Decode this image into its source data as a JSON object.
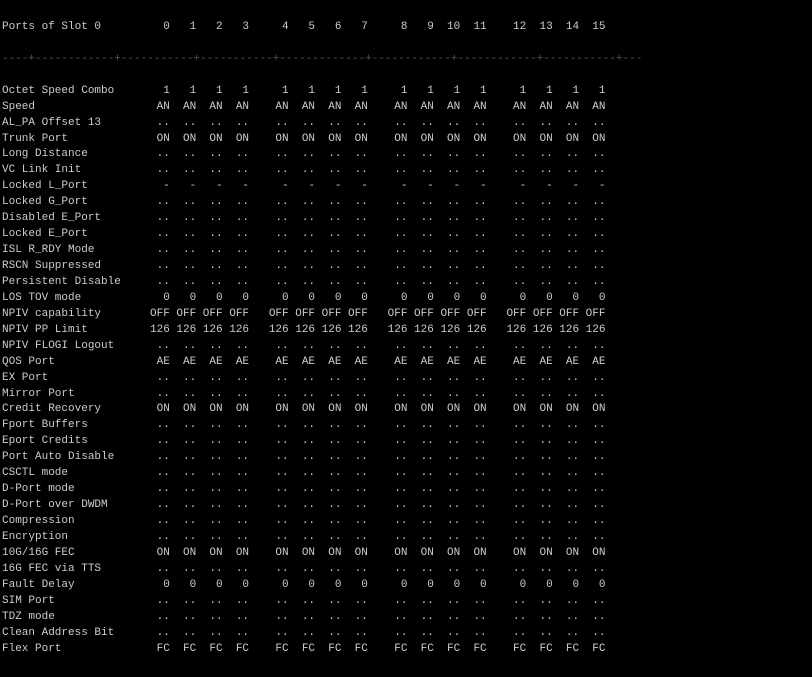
{
  "title": "Ports of Slot 0",
  "header": {
    "label": "Ports of Slot 0",
    "cols": "  0   1   2   3     4   5   6   7     8   9  10  11    12  13  14  15"
  },
  "separator": "----+---------+---------+---------+----------+---------+---------+-----------+---",
  "rows": [
    {
      "label": "Octet Speed Combo",
      "values": "  1   1   1   1     1   1   1   1     1   1   1   1     1   1   1   1"
    },
    {
      "label": "Speed",
      "values": " AN  AN  AN  AN    AN  AN  AN  AN    AN  AN  AN  AN    AN  AN  AN  AN"
    },
    {
      "label": "AL_PA Offset 13",
      "values": " ..  ..  ..  ..    ..  ..  ..  ..    ..  ..  ..  ..    ..  ..  ..  .."
    },
    {
      "label": "Trunk Port",
      "values": " ON  ON  ON  ON    ON  ON  ON  ON    ON  ON  ON  ON    ON  ON  ON  ON"
    },
    {
      "label": "Long Distance",
      "values": " ..  ..  ..  ..    ..  ..  ..  ..    ..  ..  ..  ..    ..  ..  ..  .."
    },
    {
      "label": "VC Link Init",
      "values": " ..  ..  ..  ..    ..  ..  ..  ..    ..  ..  ..  ..    ..  ..  ..  .."
    },
    {
      "label": "Locked L_Port",
      "values": "  -   -   -   -     -   -   -   -     -   -   -   -     -   -   -   -"
    },
    {
      "label": "Locked G_Port",
      "values": " ..  ..  ..  ..    ..  ..  ..  ..    ..  ..  ..  ..    ..  ..  ..  .."
    },
    {
      "label": "Disabled E_Port",
      "values": " ..  ..  ..  ..    ..  ..  ..  ..    ..  ..  ..  ..    ..  ..  ..  .."
    },
    {
      "label": "Locked E_Port",
      "values": " ..  ..  ..  ..    ..  ..  ..  ..    ..  ..  ..  ..    ..  ..  ..  .."
    },
    {
      "label": "ISL R_RDY Mode",
      "values": " ..  ..  ..  ..    ..  ..  ..  ..    ..  ..  ..  ..    ..  ..  ..  .."
    },
    {
      "label": "RSCN Suppressed",
      "values": " ..  ..  ..  ..    ..  ..  ..  ..    ..  ..  ..  ..    ..  ..  ..  .."
    },
    {
      "label": "Persistent Disable",
      "values": " ..  ..  ..  ..    ..  ..  ..  ..    ..  ..  ..  ..    ..  ..  ..  .."
    },
    {
      "label": "LOS TOV mode",
      "values": "  0   0   0   0     0   0   0   0     0   0   0   0     0   0   0   0"
    },
    {
      "label": "NPIV capability",
      "values": "OFF OFF OFF OFF   OFF OFF OFF OFF   OFF OFF OFF OFF   OFF OFF OFF OFF"
    },
    {
      "label": "NPIV PP Limit",
      "values": "126 126 126 126   126 126 126 126   126 126 126 126   126 126 126 126"
    },
    {
      "label": "NPIV FLOGI Logout",
      "values": " ..  ..  ..  ..    ..  ..  ..  ..    ..  ..  ..  ..    ..  ..  ..  .."
    },
    {
      "label": "QOS Port",
      "values": " AE  AE  AE  AE    AE  AE  AE  AE    AE  AE  AE  AE    AE  AE  AE  AE"
    },
    {
      "label": "EX Port",
      "values": " ..  ..  ..  ..    ..  ..  ..  ..    ..  ..  ..  ..    ..  ..  ..  .."
    },
    {
      "label": "Mirror Port",
      "values": " ..  ..  ..  ..    ..  ..  ..  ..    ..  ..  ..  ..    ..  ..  ..  .."
    },
    {
      "label": "Credit Recovery",
      "values": " ON  ON  ON  ON    ON  ON  ON  ON    ON  ON  ON  ON    ON  ON  ON  ON"
    },
    {
      "label": "Fport Buffers",
      "values": " ..  ..  ..  ..    ..  ..  ..  ..    ..  ..  ..  ..    ..  ..  ..  .."
    },
    {
      "label": "Eport Credits",
      "values": " ..  ..  ..  ..    ..  ..  ..  ..    ..  ..  ..  ..    ..  ..  ..  .."
    },
    {
      "label": "Port Auto Disable",
      "values": " ..  ..  ..  ..    ..  ..  ..  ..    ..  ..  ..  ..    ..  ..  ..  .."
    },
    {
      "label": "CSCTL mode",
      "values": " ..  ..  ..  ..    ..  ..  ..  ..    ..  ..  ..  ..    ..  ..  ..  .."
    },
    {
      "label": "D-Port mode",
      "values": " ..  ..  ..  ..    ..  ..  ..  ..    ..  ..  ..  ..    ..  ..  ..  .."
    },
    {
      "label": "D-Port over DWDM",
      "values": " ..  ..  ..  ..    ..  ..  ..  ..    ..  ..  ..  ..    ..  ..  ..  .."
    },
    {
      "label": "Compression",
      "values": " ..  ..  ..  ..    ..  ..  ..  ..    ..  ..  ..  ..    ..  ..  ..  .."
    },
    {
      "label": "Encryption",
      "values": " ..  ..  ..  ..    ..  ..  ..  ..    ..  ..  ..  ..    ..  ..  ..  .."
    },
    {
      "label": "10G/16G FEC",
      "values": " ON  ON  ON  ON    ON  ON  ON  ON    ON  ON  ON  ON    ON  ON  ON  ON"
    },
    {
      "label": "16G FEC via TTS",
      "values": " ..  ..  ..  ..    ..  ..  ..  ..    ..  ..  ..  ..    ..  ..  ..  .."
    },
    {
      "label": "Fault Delay",
      "values": "  0   0   0   0     0   0   0   0     0   0   0   0     0   0   0   0"
    },
    {
      "label": "SIM Port",
      "values": " ..  ..  ..  ..    ..  ..  ..  ..    ..  ..  ..  ..    ..  ..  ..  .."
    },
    {
      "label": "TDZ mode",
      "values": " ..  ..  ..  ..    ..  ..  ..  ..    ..  ..  ..  ..    ..  ..  ..  .."
    },
    {
      "label": "Clean Address Bit",
      "values": " ..  ..  ..  ..    ..  ..  ..  ..    ..  ..  ..  ..    ..  ..  ..  .."
    },
    {
      "label": "Flex Port",
      "values": " FC  FC  FC  FC    FC  FC  FC  FC    FC  FC  FC  FC    FC  FC  FC  FC"
    }
  ]
}
